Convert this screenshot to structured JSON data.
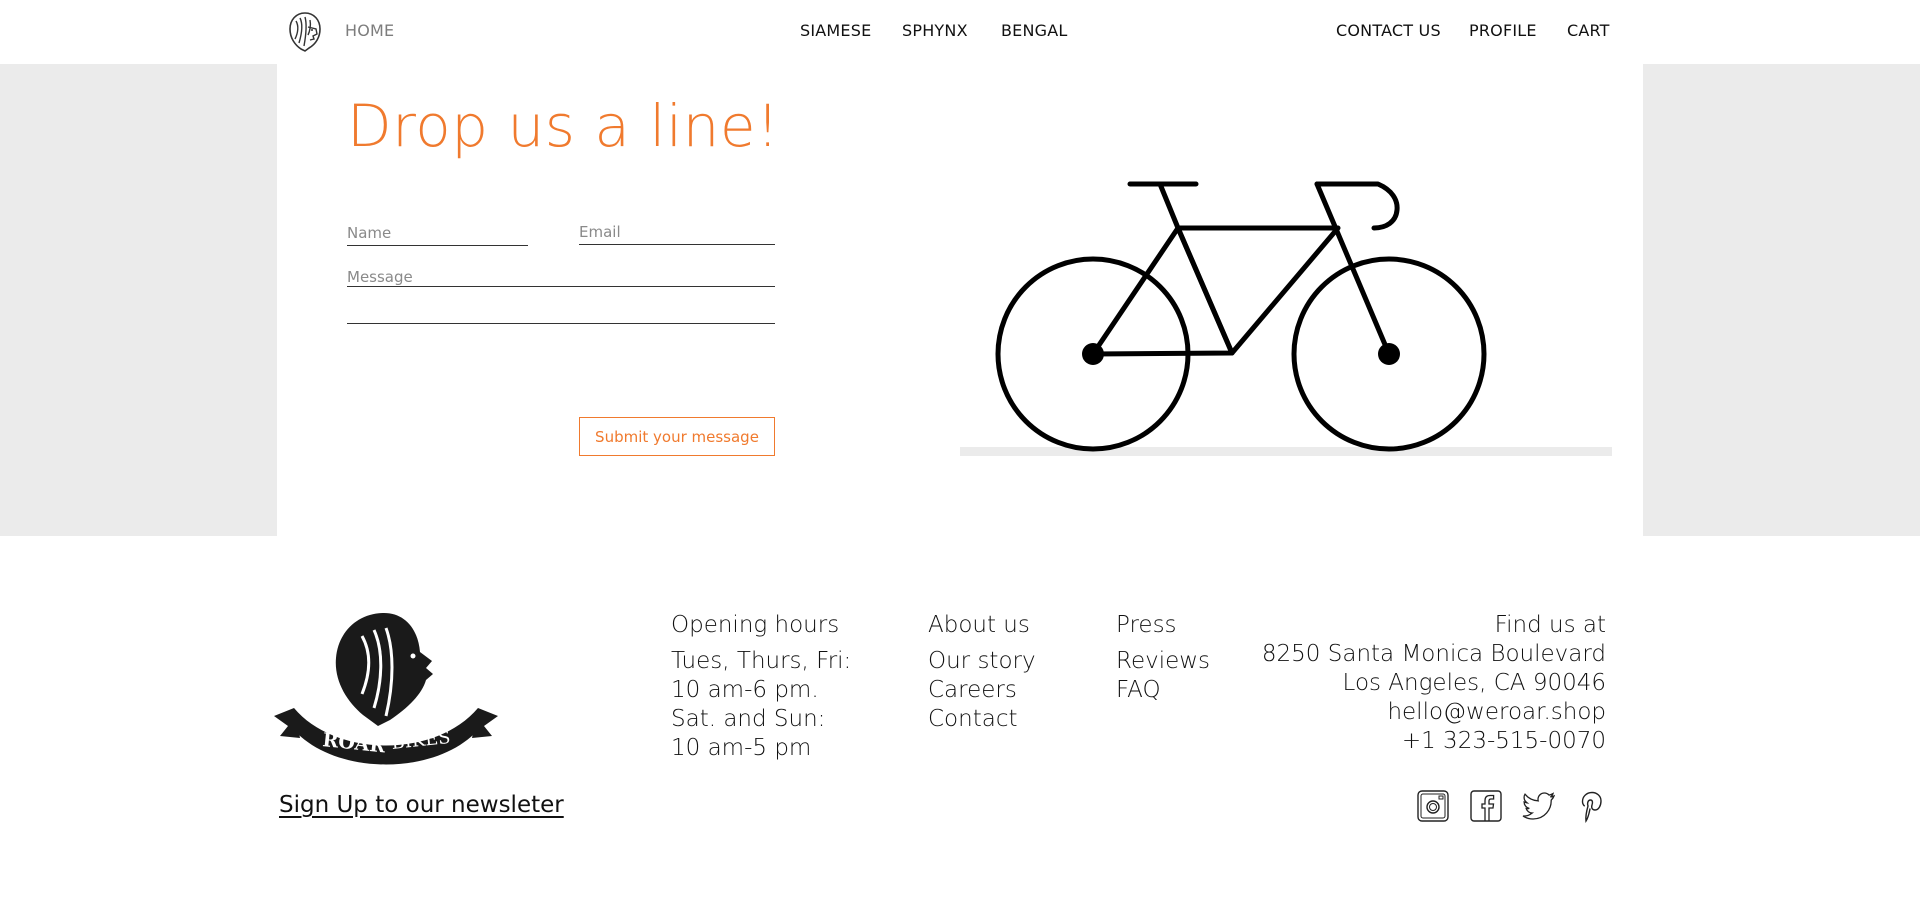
{
  "header": {
    "home_label": "HOME",
    "nav_center": [
      "SIAMESE",
      "SPHYNX",
      "BENGAL"
    ],
    "nav_right": [
      "CONTACT US",
      "PROFILE",
      "CART"
    ]
  },
  "contact": {
    "heading": "Drop us a line!",
    "name_placeholder": "Name",
    "email_placeholder": "Email",
    "message_placeholder": "Message",
    "submit_label": "Submit your message"
  },
  "footer": {
    "logo_text_bold": "ROAR",
    "logo_text_light": "BIKES",
    "newsletter_label": "Sign Up to our newsleter",
    "hours": {
      "title": "Opening hours",
      "lines": [
        "Tues, Thurs, Fri:",
        "10 am-6 pm.",
        "Sat. and Sun:",
        "10 am-5 pm"
      ]
    },
    "about": {
      "title": "About us",
      "links": [
        "Our story",
        "Careers",
        "Contact"
      ]
    },
    "press": {
      "title": "Press",
      "links": [
        "Reviews",
        "FAQ"
      ]
    },
    "find": {
      "title": "Find us at",
      "lines": [
        "8250 Santa Monica Boulevard",
        "Los Angeles, CA 90046",
        "hello@weroar.shop",
        "+1 323-515-0070"
      ]
    },
    "social": [
      "instagram-icon",
      "facebook-icon",
      "twitter-icon",
      "pinterest-icon"
    ]
  },
  "colors": {
    "accent": "#f07a2e",
    "band": "#ebebeb",
    "text": "#111111"
  }
}
